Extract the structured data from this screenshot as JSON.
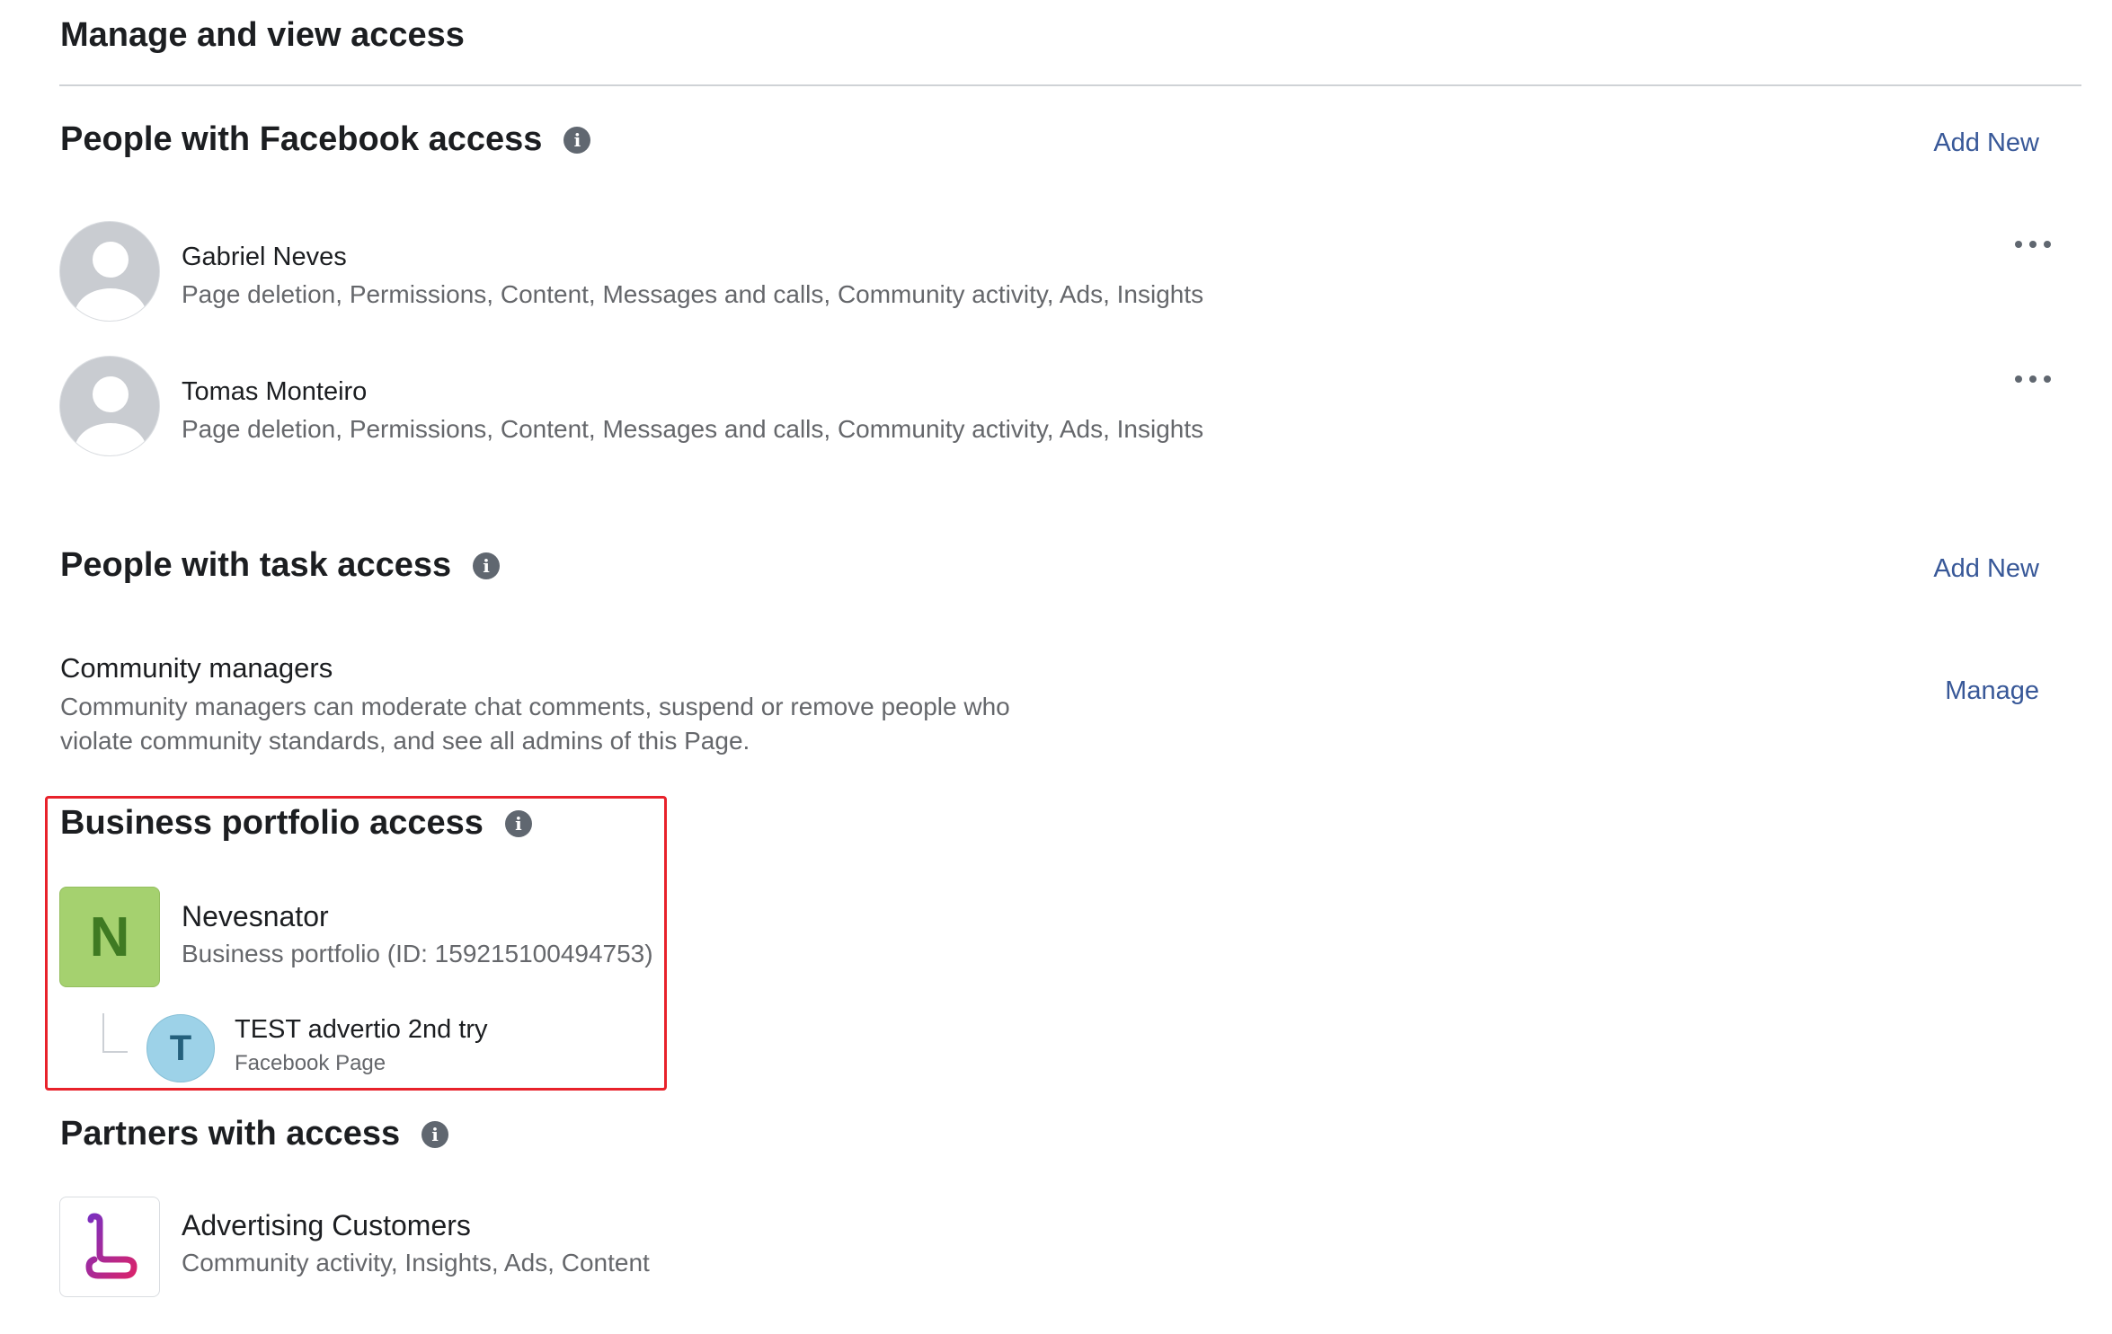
{
  "page": {
    "title": "Manage and view access"
  },
  "facebook_access": {
    "title": "People with Facebook access",
    "add_new_label": "Add New",
    "people": [
      {
        "name": "Gabriel Neves",
        "permissions": "Page deletion, Permissions, Content, Messages and calls, Community activity, Ads, Insights"
      },
      {
        "name": "Tomas Monteiro",
        "permissions": "Page deletion, Permissions, Content, Messages and calls, Community activity, Ads, Insights"
      }
    ]
  },
  "task_access": {
    "title": "People with task access",
    "add_new_label": "Add New",
    "community_managers": {
      "title": "Community managers",
      "description": "Community managers can moderate chat comments, suspend or remove people who violate community standards, and see all admins of this Page.",
      "manage_label": "Manage"
    }
  },
  "business_portfolio": {
    "title": "Business portfolio access",
    "portfolio": {
      "initial": "N",
      "name": "Nevesnator",
      "detail": "Business portfolio (ID: 159215100494753)"
    },
    "asset": {
      "initial": "T",
      "name": "TEST advertio 2nd try",
      "type": "Facebook Page"
    }
  },
  "partners": {
    "title": "Partners with access",
    "items": [
      {
        "name": "Advertising Customers",
        "permissions": "Community activity, Insights, Ads, Content"
      }
    ]
  },
  "icons": {
    "info": "info-icon",
    "more": "more-options-icon",
    "avatar": "default-person-avatar-icon",
    "partner_logo": "partner-logo-icon"
  },
  "colors": {
    "link": "#385898",
    "highlight_border": "#e8222b",
    "portfolio_avatar": "#a5d16f",
    "page_avatar": "#9dd2e8"
  }
}
